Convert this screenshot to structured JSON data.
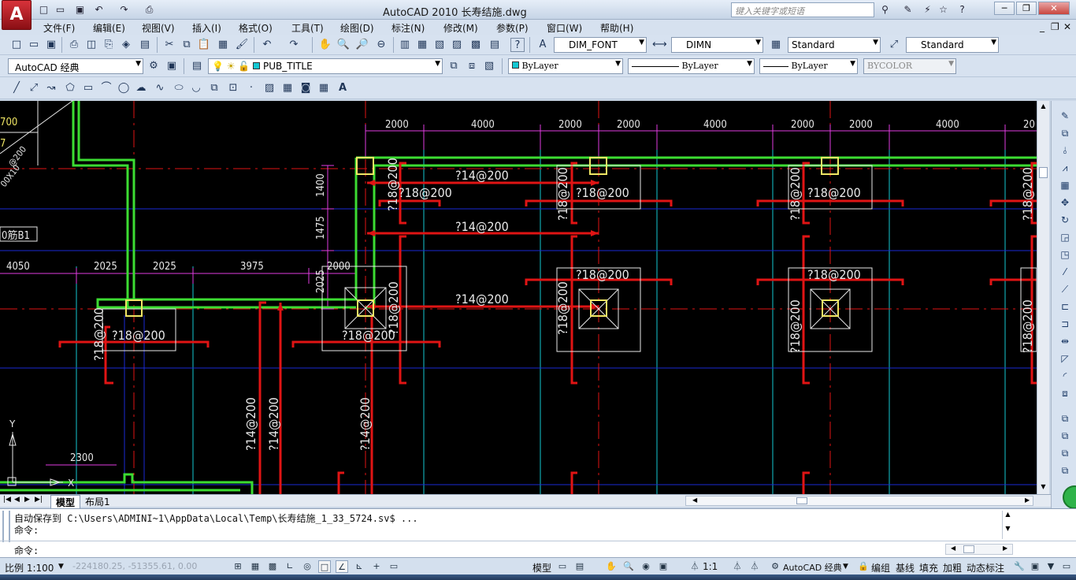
{
  "titlebar": {
    "logo": "A",
    "title": "AutoCAD 2010    长寿结施.dwg",
    "search_placeholder": "键入关键字或短语",
    "quick_access_icons": [
      "new-icon",
      "open-icon",
      "save-icon",
      "undo-icon",
      "redo-icon",
      "plot-icon"
    ],
    "window_controls": [
      "─",
      "❐",
      "✕"
    ]
  },
  "menubar": {
    "items": [
      "文件(F)",
      "编辑(E)",
      "视图(V)",
      "插入(I)",
      "格式(O)",
      "工具(T)",
      "绘图(D)",
      "标注(N)",
      "修改(M)",
      "参数(P)",
      "窗口(W)",
      "帮助(H)"
    ]
  },
  "toolbar2": {
    "text_style": "DIM_FONT",
    "dim_style": "DIMN",
    "table_style": "Standard",
    "mleader_style": "Standard"
  },
  "toolbar3": {
    "workspace": "AutoCAD 经典",
    "layer": "PUB_TITLE",
    "color": "ByLayer",
    "linetype": "ByLayer",
    "lineweight": "ByLayer",
    "plotstyle": "BYCOLOR"
  },
  "drawing": {
    "top_dims": [
      "2000",
      "4000",
      "2000",
      "2000",
      "4000",
      "2000",
      "2000",
      "4000",
      "20"
    ],
    "left_dims": [
      "4050",
      "2025",
      "2025",
      "3975",
      "2000"
    ],
    "vertical_dims": [
      "1400",
      "1475",
      "2025"
    ],
    "left_box_label": "0筋B1",
    "left_top_text": [
      "700",
      "7",
      "@200",
      "00X10"
    ],
    "rebar_labels": {
      "h1": "?14@200",
      "h2": "?14@200",
      "h3": "?14@200",
      "p18": "?18@200",
      "v14": "?14@200"
    },
    "dim_2300": "2300",
    "ucs_y": "Y",
    "ucs_x": "X"
  },
  "layout_tabs": [
    "模型",
    "布局1"
  ],
  "command": {
    "line1": "自动保存到 C:\\Users\\ADMINI~1\\AppData\\Local\\Temp\\长寿结施_1_33_5724.sv$ ...",
    "line2": "命令:",
    "line3": "命令:"
  },
  "status": {
    "scale": "比例 1:100",
    "coords": "-224180.25, -51355.61, 0.00",
    "model": "模型",
    "anno_scale": "1:1",
    "workspace": "AutoCAD 经典",
    "mode_buttons": [
      "编组",
      "基线",
      "填充",
      "加粗",
      "动态标注"
    ]
  },
  "colors": {
    "canvas": "#000000",
    "green": "#3cdc32",
    "red": "#e01414",
    "magenta": "#e03ce0",
    "cyan": "#14c8d2",
    "blue": "#1a2ad4",
    "yellow": "#f0e664"
  }
}
